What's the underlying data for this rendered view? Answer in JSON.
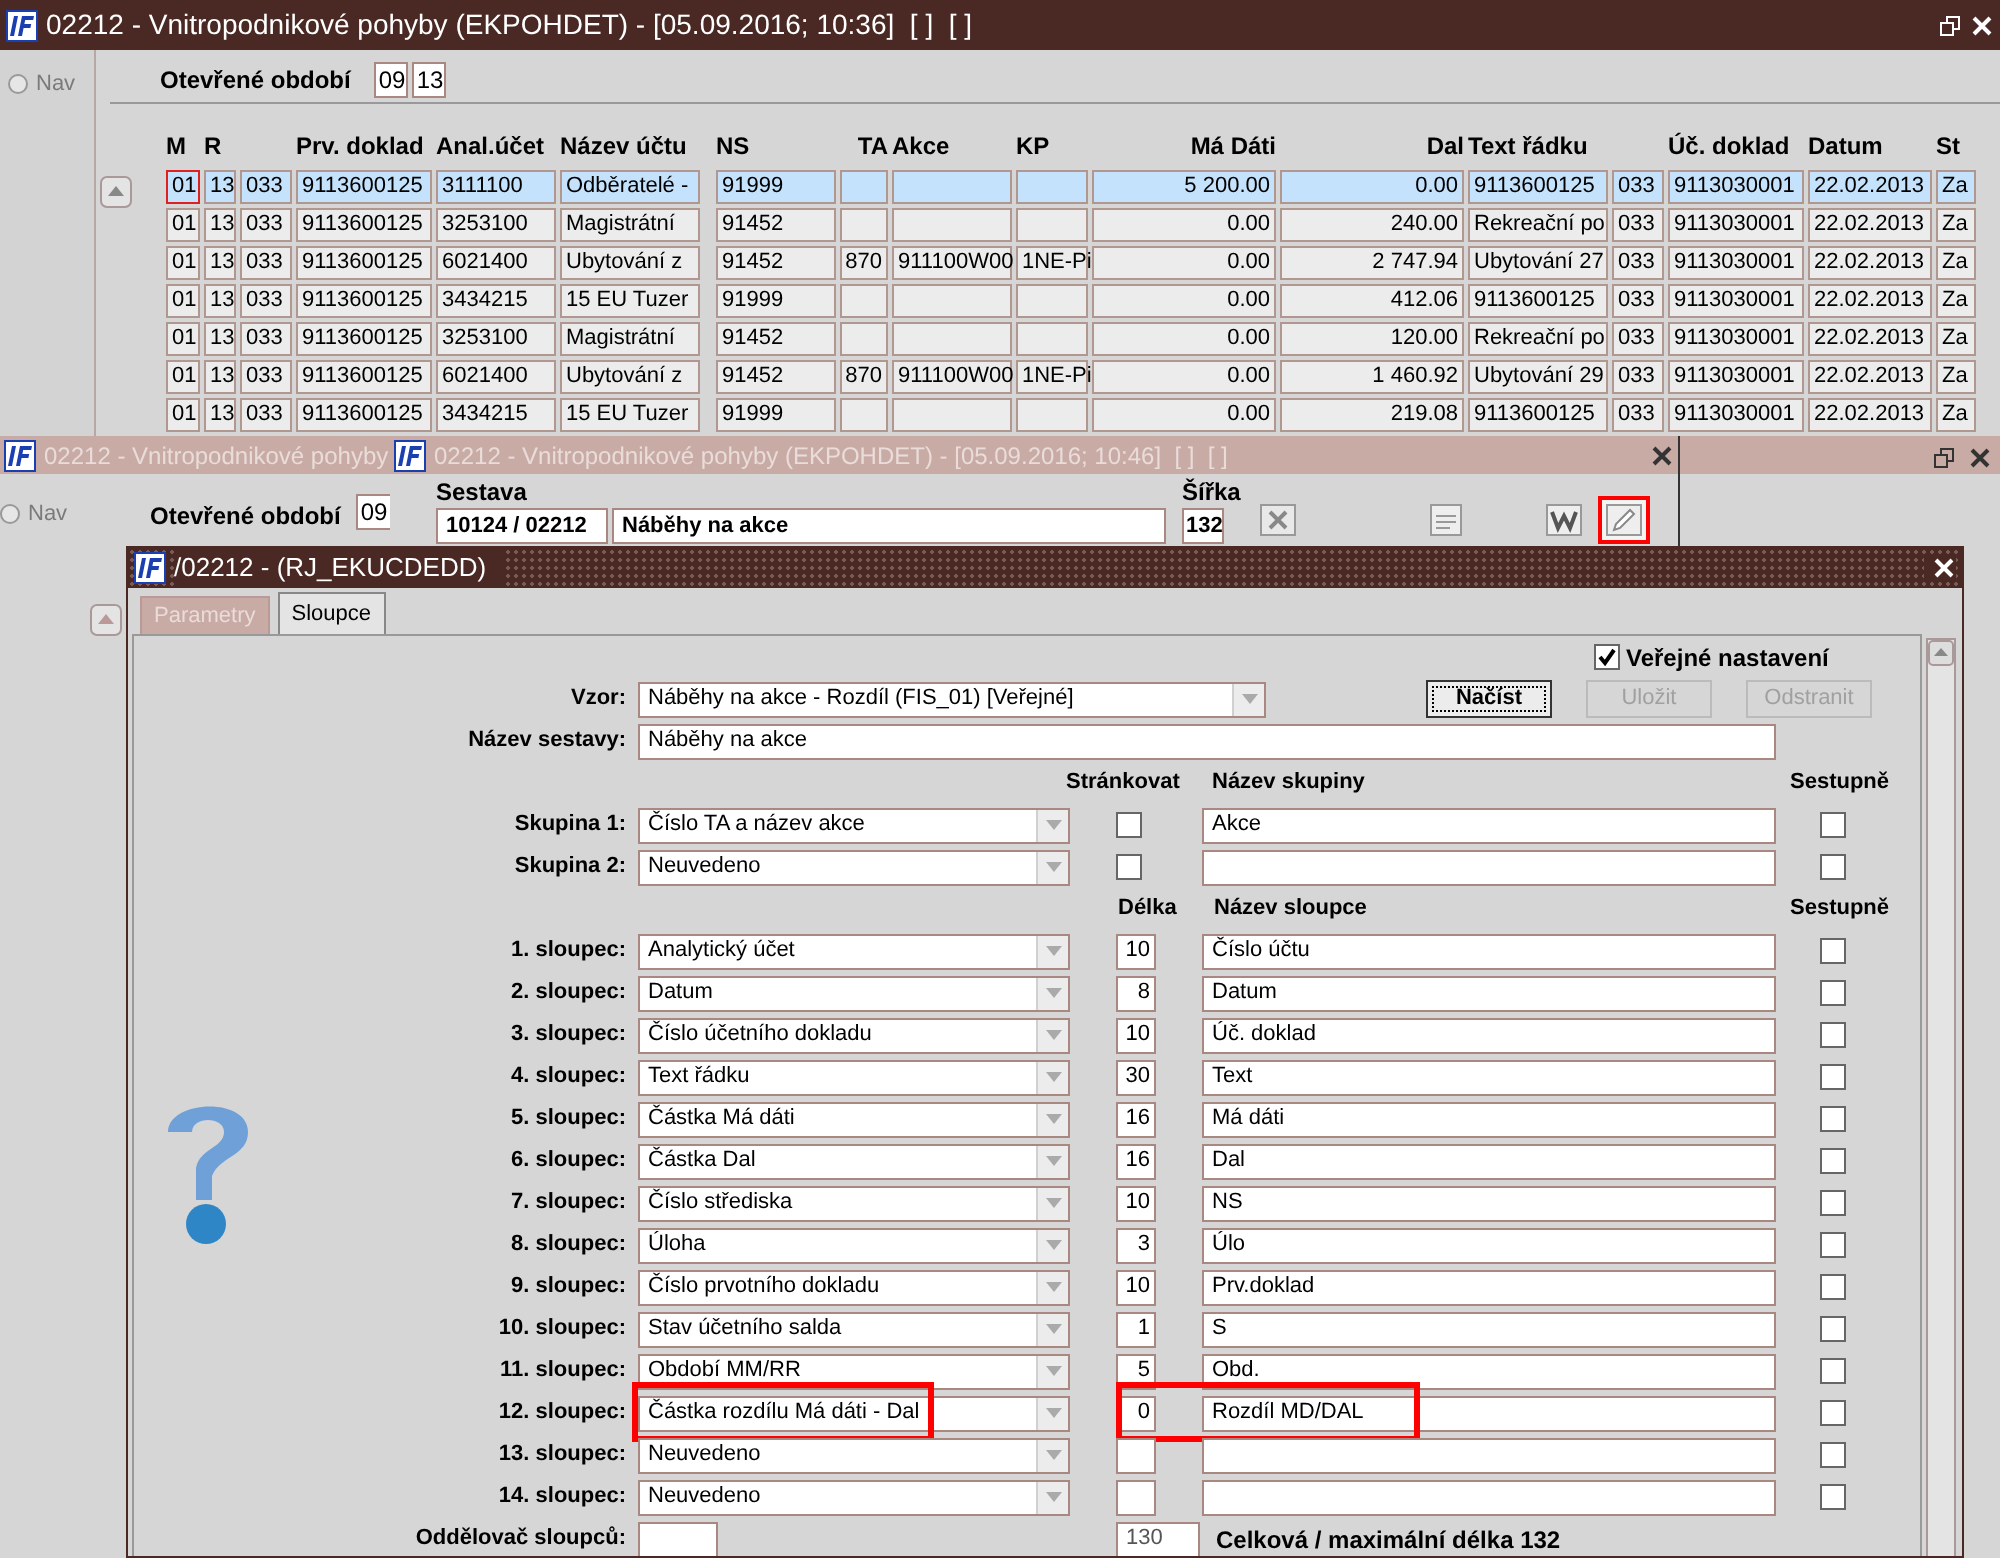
{
  "main_window": {
    "title": "02212 - Vnitropodnikové pohyby (EKPOHDET) - [05.09.2016; 10:36]  [ ]  [ ]",
    "nav_label": "Nav",
    "nav_selected": false,
    "period_label": "Otevřené období",
    "period_month": "09",
    "period_year": "13",
    "table": {
      "columns": [
        "M",
        "R",
        "",
        "Prv. doklad",
        "Anal.účet",
        "Název účtu",
        "NS",
        "TA",
        "Akce",
        "KP",
        "Má Dáti",
        "Dal",
        "Text řádku",
        "",
        "Úč. doklad",
        "Datum",
        "St"
      ],
      "rows": [
        {
          "selected": true,
          "cells": [
            "01",
            "13",
            "033",
            "9113600125",
            "3111100",
            "Odběratelé -",
            "91999",
            "",
            "",
            "",
            "5 200.00",
            "0.00",
            "9113600125",
            "033",
            "9113030001",
            "22.02.2013",
            "Za"
          ]
        },
        {
          "selected": false,
          "cells": [
            "01",
            "13",
            "033",
            "9113600125",
            "3253100",
            "Magistrátní",
            "91452",
            "",
            "",
            "",
            "0.00",
            "240.00",
            "Rekreační po",
            "033",
            "9113030001",
            "22.02.2013",
            "Za"
          ]
        },
        {
          "selected": false,
          "cells": [
            "01",
            "13",
            "033",
            "9113600125",
            "6021400",
            "Ubytování z",
            "91452",
            "870",
            "911100W00",
            "1NE-Pi",
            "0.00",
            "2 747.94",
            "Ubytování 27",
            "033",
            "9113030001",
            "22.02.2013",
            "Za"
          ]
        },
        {
          "selected": false,
          "cells": [
            "01",
            "13",
            "033",
            "9113600125",
            "3434215",
            "15 EU Tuzer",
            "91999",
            "",
            "",
            "",
            "0.00",
            "412.06",
            "9113600125",
            "033",
            "9113030001",
            "22.02.2013",
            "Za"
          ]
        },
        {
          "selected": false,
          "cells": [
            "01",
            "13",
            "033",
            "9113600125",
            "3253100",
            "Magistrátní",
            "91452",
            "",
            "",
            "",
            "0.00",
            "120.00",
            "Rekreační po",
            "033",
            "9113030001",
            "22.02.2013",
            "Za"
          ]
        },
        {
          "selected": false,
          "cells": [
            "01",
            "13",
            "033",
            "9113600125",
            "6021400",
            "Ubytování z",
            "91452",
            "870",
            "911100W00",
            "1NE-Pi",
            "0.00",
            "1 460.92",
            "Ubytování 29",
            "033",
            "9113030001",
            "22.02.2013",
            "Za"
          ]
        },
        {
          "selected": false,
          "cells": [
            "01",
            "13",
            "033",
            "9113600125",
            "3434215",
            "15 EU Tuzer",
            "91999",
            "",
            "",
            "",
            "0.00",
            "219.08",
            "9113600125",
            "033",
            "9113030001",
            "22.02.2013",
            "Za"
          ]
        }
      ]
    }
  },
  "second_window": {
    "title": "02212 - Vnitropodnikové pohyby",
    "nav_label": "Nav",
    "nav_selected": false,
    "period_label": "Otevřené období",
    "period_month": "09"
  },
  "report_window": {
    "title": "02212 - Vnitropodnikové pohyby (EKPOHDET) - [05.09.2016; 10:46]  [ ]  [ ]",
    "report_label": "Sestava",
    "report_code": "10124 / 02212",
    "report_name": "Náběhy na akce",
    "width_label": "Šířka",
    "width_value": "132",
    "tools": [
      {
        "kind": "spreadsheet",
        "highlighted": false
      },
      {
        "kind": "xml",
        "highlighted": false
      },
      {
        "kind": "word",
        "highlighted": false
      },
      {
        "kind": "edit",
        "highlighted": true
      }
    ]
  },
  "dialog": {
    "title": "/02212 - (RJ_EKUCDEDD)",
    "tabs": [
      {
        "label": "Parametry",
        "selected": false
      },
      {
        "label": "Sloupce",
        "selected": true
      }
    ],
    "public_setting": {
      "label": "Veřejné nastavení",
      "checked": true
    },
    "template": {
      "label": "Vzor:",
      "value": "Náběhy na akce - Rozdíl   (FIS_01)   [Veřejné]"
    },
    "buttons": [
      {
        "label": "Načíst",
        "disabled": false
      },
      {
        "label": "Uložit",
        "disabled": true
      },
      {
        "label": "Odstranit",
        "disabled": true
      }
    ],
    "report_name": {
      "label": "Název sestavy:",
      "value": "Náběhy na akce"
    },
    "group_headers": {
      "paginate": "Stránkovat",
      "name": "Název skupiny",
      "descending": "Sestupně"
    },
    "groups": [
      {
        "label": "Skupina 1:",
        "value": "Číslo TA a název akce",
        "paginate": false,
        "name": "Akce",
        "descending": false
      },
      {
        "label": "Skupina 2:",
        "value": "Neuvedeno",
        "paginate": false,
        "descending": false
      }
    ],
    "column_headers": {
      "length": "Délka",
      "name": "Název sloupce",
      "descending": "Sestupně"
    },
    "columns": [
      {
        "label": "1. sloupec:",
        "value": "Analytický účet",
        "length": "10",
        "name": "Číslo účtu",
        "descending": false,
        "highlighted": false
      },
      {
        "label": "2. sloupec:",
        "value": "Datum",
        "length": "8",
        "name": "Datum",
        "descending": false,
        "highlighted": false
      },
      {
        "label": "3. sloupec:",
        "value": "Číslo účetního dokladu",
        "length": "10",
        "name": "Úč. doklad",
        "descending": false,
        "highlighted": false
      },
      {
        "label": "4. sloupec:",
        "value": "Text řádku",
        "length": "30",
        "name": "Text",
        "descending": false,
        "highlighted": false
      },
      {
        "label": "5. sloupec:",
        "value": "Částka Má dáti",
        "length": "16",
        "name": "Má dáti",
        "descending": false,
        "highlighted": false
      },
      {
        "label": "6. sloupec:",
        "value": "Částka Dal",
        "length": "16",
        "name": "Dal",
        "descending": false,
        "highlighted": false
      },
      {
        "label": "7. sloupec:",
        "value": "Číslo střediska",
        "length": "10",
        "name": "NS",
        "descending": false,
        "highlighted": false
      },
      {
        "label": "8. sloupec:",
        "value": "Úloha",
        "length": "3",
        "name": "Úlo",
        "descending": false,
        "highlighted": false
      },
      {
        "label": "9. sloupec:",
        "value": "Číslo prvotního dokladu",
        "length": "10",
        "name": "Prv.doklad",
        "descending": false,
        "highlighted": false
      },
      {
        "label": "10. sloupec:",
        "value": "Stav účetního salda",
        "length": "1",
        "name": "S",
        "descending": false,
        "highlighted": false
      },
      {
        "label": "11. sloupec:",
        "value": "Období MM/RR",
        "length": "5",
        "name": "Obd.",
        "descending": false,
        "highlighted": false
      },
      {
        "label": "12. sloupec:",
        "value": "Částka rozdílu Má dáti - Dal",
        "length": "0",
        "name": "Rozdíl MD/DAL",
        "descending": false,
        "highlighted": true
      },
      {
        "label": "13. sloupec:",
        "value": "Neuvedeno",
        "descending": false,
        "highlighted": false
      },
      {
        "label": "14. sloupec:",
        "value": "Neuvedeno",
        "descending": false,
        "highlighted": false
      }
    ],
    "separator": {
      "label": "Oddělovač sloupců:"
    },
    "total_length": "130",
    "total_label": "Celková / maximální délka 132"
  }
}
